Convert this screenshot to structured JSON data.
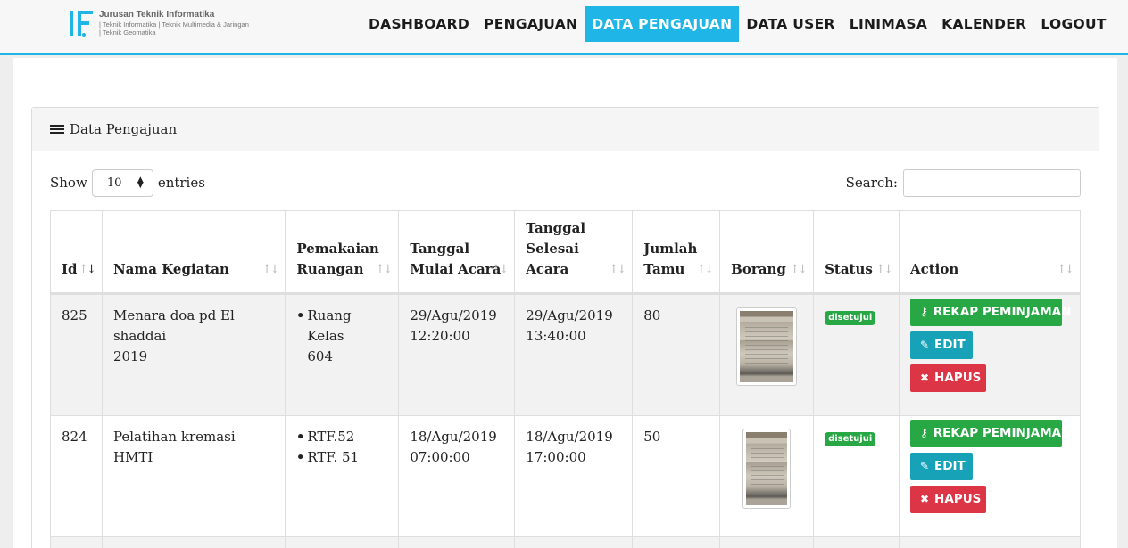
{
  "brand": {
    "title": "Jurusan Teknik Informatika",
    "subtitle_1": "| Teknik Informatika | Teknik Multimedia & Jaringan",
    "subtitle_2": "| Teknik Geomatika",
    "logo_icon": "if-logo-icon",
    "accent_color": "#1fb5e6"
  },
  "nav": {
    "items": [
      {
        "label": "DASHBOARD",
        "active": false
      },
      {
        "label": "PENGAJUAN",
        "active": false
      },
      {
        "label": "DATA PENGAJUAN",
        "active": true
      },
      {
        "label": "DATA USER",
        "active": false
      },
      {
        "label": "LINIMASA",
        "active": false
      },
      {
        "label": "KALENDER",
        "active": false
      },
      {
        "label": "LOGOUT",
        "active": false
      }
    ]
  },
  "panel": {
    "icon": "list-icon",
    "title": "Data Pengajuan"
  },
  "controls": {
    "show_label": "Show",
    "entries_value": "10",
    "entries_label": "entries",
    "search_label": "Search:",
    "search_value": ""
  },
  "table": {
    "headers": [
      {
        "line1": "Id",
        "line2": "",
        "line3": ""
      },
      {
        "line1": "Nama Kegiatan",
        "line2": "",
        "line3": ""
      },
      {
        "line1": "Pemakaian",
        "line2": "Ruangan",
        "line3": ""
      },
      {
        "line1": "Tanggal",
        "line2": "Mulai Acara",
        "line3": ""
      },
      {
        "line1": "Tanggal",
        "line2": "Selesai",
        "line3": "Acara"
      },
      {
        "line1": "Jumlah",
        "line2": "Tamu",
        "line3": ""
      },
      {
        "line1": "Borang",
        "line2": "",
        "line3": ""
      },
      {
        "line1": "Status",
        "line2": "",
        "line3": ""
      },
      {
        "line1": "Action",
        "line2": "",
        "line3": ""
      }
    ],
    "rows": [
      {
        "id": "825",
        "nama_line1": "Menara doa pd El shaddai",
        "nama_line2": "2019",
        "ruangan": [
          "Ruang Kelas",
          "604"
        ],
        "mulai_date": "29/Agu/2019",
        "mulai_time": "12:20:00",
        "selesai_date": "29/Agu/2019",
        "selesai_time": "13:40:00",
        "tamu": "80",
        "status": "disetujui"
      },
      {
        "id": "824",
        "nama_line1": "Pelatihan kremasi HMTI",
        "nama_line2": "",
        "ruangan": [
          "RTF.52",
          "RTF. 51"
        ],
        "mulai_date": "18/Agu/2019",
        "mulai_time": "07:00:00",
        "selesai_date": "18/Agu/2019",
        "selesai_time": "17:00:00",
        "tamu": "50",
        "status": "disetujui"
      }
    ],
    "actions": {
      "rekap_label": "REKAP PEMINJAMAN",
      "edit_label": "EDIT",
      "hapus_label": "HAPUS",
      "rekap_icon": "key-icon",
      "edit_icon": "pencil-icon",
      "hapus_icon": "close-icon",
      "rekap_color": "#28a745",
      "edit_color": "#17a2b8",
      "hapus_color": "#dc3545"
    }
  }
}
